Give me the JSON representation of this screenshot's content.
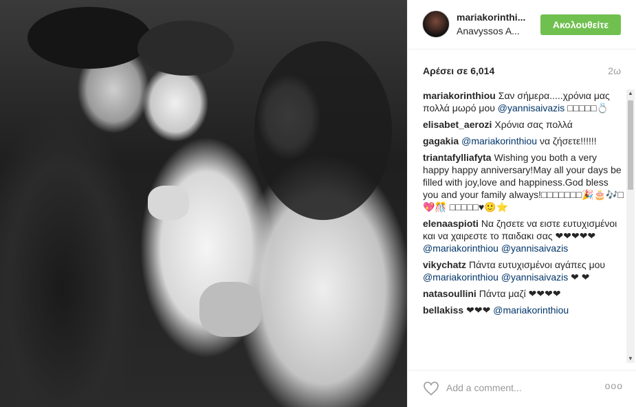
{
  "post": {
    "username": "mariakorinthi...",
    "location": "Anavyssos A...",
    "follow_label": "Ακολουθείτε",
    "likes_text": "Αρέσει σε 6,014",
    "time_ago": "2ω"
  },
  "comments": [
    {
      "user": "mariakorinthiou",
      "parts": [
        {
          "t": "Σαν σήμερα.....χρόνια μας πολλά μωρό μου "
        },
        {
          "m": "@yannisaivazis"
        },
        {
          "t": " □□□□□💍"
        }
      ]
    },
    {
      "user": "elisabet_aerozi",
      "parts": [
        {
          "t": "Χρόνια σας πολλά"
        }
      ]
    },
    {
      "user": "gagakia",
      "parts": [
        {
          "m": "@mariakorinthiou"
        },
        {
          "t": " να ζήσετε!!!!!!"
        }
      ]
    },
    {
      "user": "triantafylliafyta",
      "parts": [
        {
          "t": "Wishing you both a very happy happy anniversary!May all your days be filled with joy,love and happiness.God bless you and your family always!□□□□□□□🎉🎂🎶□💖🎊 □□□□□♥🙂⭐"
        }
      ]
    },
    {
      "user": "elenaaspioti",
      "parts": [
        {
          "t": "Να ζησετε να ειστε ευτυχισμένοι και να χαιρεστε το παιδακι σας ❤❤❤❤❤"
        },
        {
          "m": "@mariakorinthiou"
        },
        {
          "t": " "
        },
        {
          "m": "@yannisaivazis"
        }
      ]
    },
    {
      "user": "vikychatz",
      "parts": [
        {
          "t": "Πάντα ευτυχισμένοι αγάπες μου "
        },
        {
          "m": "@mariakorinthiou"
        },
        {
          "t": " "
        },
        {
          "m": "@yannisaivazis"
        },
        {
          "t": " ❤ ❤"
        }
      ]
    },
    {
      "user": "natasoullini",
      "parts": [
        {
          "t": "Πάντα μαζί ❤❤❤❤"
        }
      ]
    },
    {
      "user": "bellakiss",
      "parts": [
        {
          "t": "❤❤❤ "
        },
        {
          "m": "@mariakorinthiou"
        }
      ]
    }
  ],
  "footer": {
    "comment_placeholder": "Add a comment...",
    "more_label": "ooo"
  },
  "icons": {
    "like": "heart-icon",
    "more": "more-options-icon",
    "scroll_up": "scroll-up-arrow-icon",
    "scroll_down": "scroll-down-arrow-icon"
  },
  "colors": {
    "follow_button": "#70c050",
    "mention": "#003569",
    "muted": "#999999"
  }
}
